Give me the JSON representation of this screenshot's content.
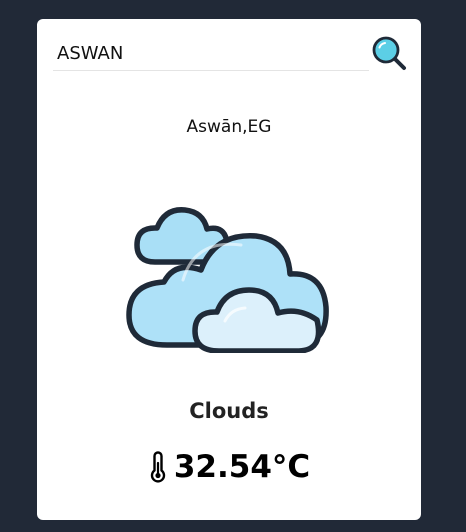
{
  "search": {
    "value": "ASWAN",
    "icon": "search-icon"
  },
  "weather": {
    "location": "Aswān,EG",
    "icon": "clouds-icon",
    "condition": "Clouds",
    "temperature": "32.54°C",
    "temperature_icon": "thermometer-icon"
  },
  "colors": {
    "background": "#212937",
    "card": "#ffffff",
    "accent": "#5ccfe6"
  }
}
